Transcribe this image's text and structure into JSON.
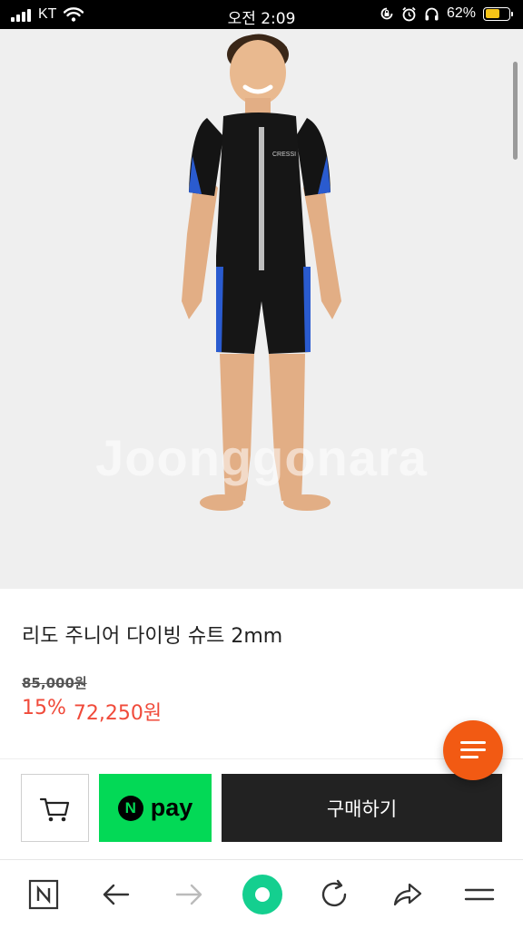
{
  "status_bar": {
    "carrier": "KT",
    "time": "오전 2:09",
    "battery_percent": "62%",
    "battery_level": 0.62,
    "icons": [
      "signal-icon",
      "wifi-icon",
      "rotation-lock-icon",
      "alarm-icon",
      "headphones-icon",
      "battery-icon"
    ]
  },
  "product": {
    "watermark": "Joonggonara",
    "title": "리도 주니어 다이빙 슈트 2mm",
    "original_price": "85,000원",
    "discount": "15%",
    "sale_price": "72,250원"
  },
  "actions": {
    "npay_logo": "N",
    "npay_label": "pay",
    "buy_label": "구매하기"
  },
  "browser_nav": {
    "items": [
      "naver-home-icon",
      "back-arrow-icon",
      "forward-arrow-icon",
      "green-dot-icon",
      "refresh-icon",
      "share-icon",
      "menu-icon"
    ]
  },
  "colors": {
    "sale_red": "#f04a3a",
    "fab_orange": "#f25a13",
    "npay_green": "#03d956",
    "buy_dark": "#222222",
    "nav_green": "#14cf8f",
    "battery_yellow": "#f6c417"
  }
}
